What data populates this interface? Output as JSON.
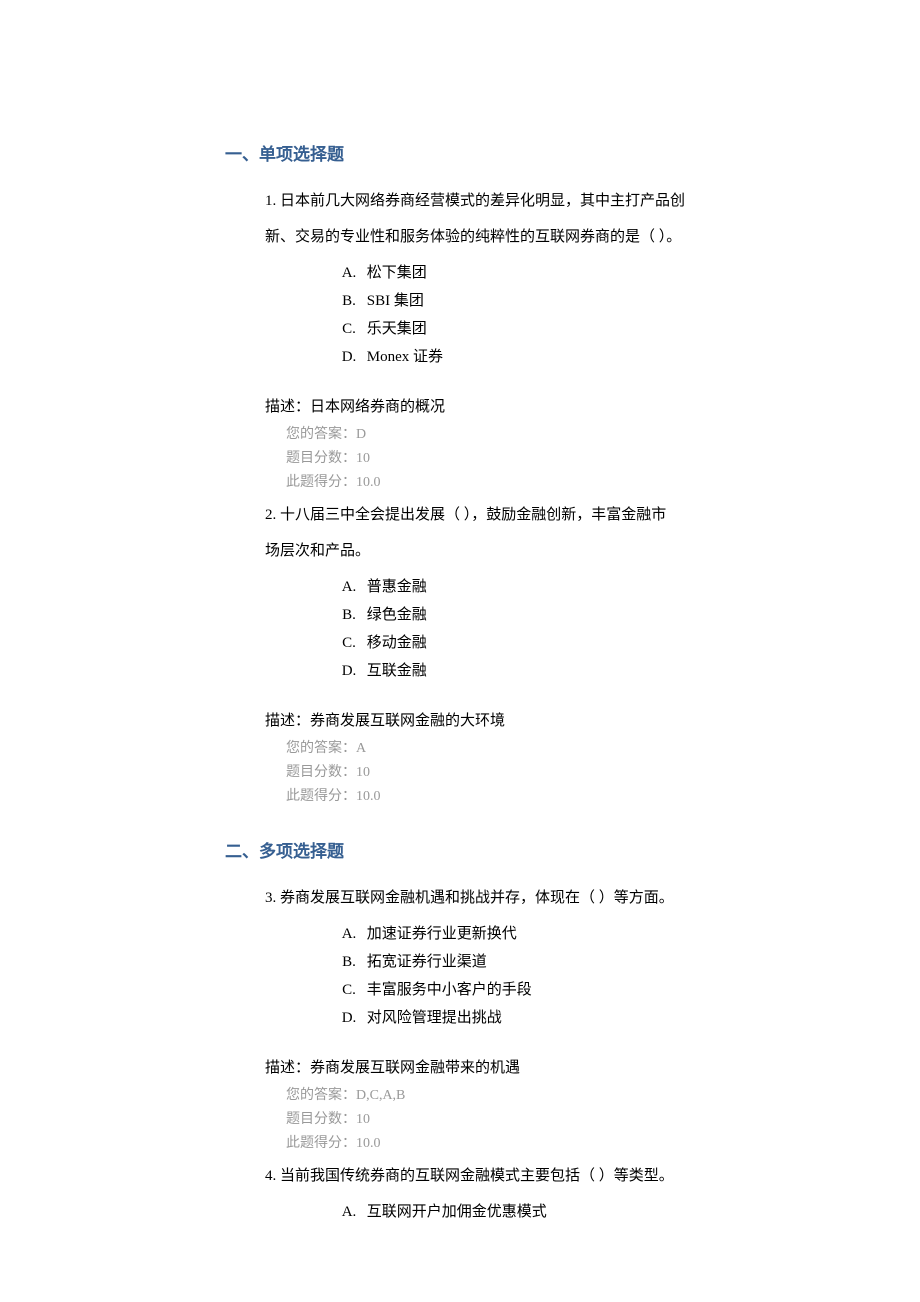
{
  "section1": {
    "heading": "一、单项选择题",
    "q1": {
      "text_l1": "1. 日本前几大网络券商经营模式的差异化明显，其中主打产品创",
      "text_l2": "新、交易的专业性和服务体验的纯粹性的互联网券商的是（ ）。",
      "optA": "松下集团",
      "optB": "SBI 集团",
      "optC": "乐天集团",
      "optD": "Monex 证券",
      "desc": "描述：日本网络券商的概况",
      "your_answer": "您的答案：D",
      "score": "题目分数：10",
      "got": "此题得分：10.0"
    },
    "q2": {
      "text_l1": "2. 十八届三中全会提出发展（ ），鼓励金融创新，丰富金融市",
      "text_l2": "场层次和产品。",
      "optA": "普惠金融",
      "optB": "绿色金融",
      "optC": "移动金融",
      "optD": "互联金融",
      "desc": "描述：券商发展互联网金融的大环境",
      "your_answer": "您的答案：A",
      "score": "题目分数：10",
      "got": "此题得分：10.0"
    }
  },
  "section2": {
    "heading": "二、多项选择题",
    "q3": {
      "text": "3. 券商发展互联网金融机遇和挑战并存，体现在（ ）等方面。",
      "optA": "加速证券行业更新换代",
      "optB": "拓宽证券行业渠道",
      "optC": "丰富服务中小客户的手段",
      "optD": "对风险管理提出挑战",
      "desc": "描述：券商发展互联网金融带来的机遇",
      "your_answer": "您的答案：D,C,A,B",
      "score": "题目分数：10",
      "got": "此题得分：10.0"
    },
    "q4": {
      "text": "4. 当前我国传统券商的互联网金融模式主要包括（ ）等类型。",
      "optA": "互联网开户加佣金优惠模式"
    }
  },
  "labels": {
    "A": "A.",
    "B": "B.",
    "C": "C.",
    "D": "D."
  }
}
